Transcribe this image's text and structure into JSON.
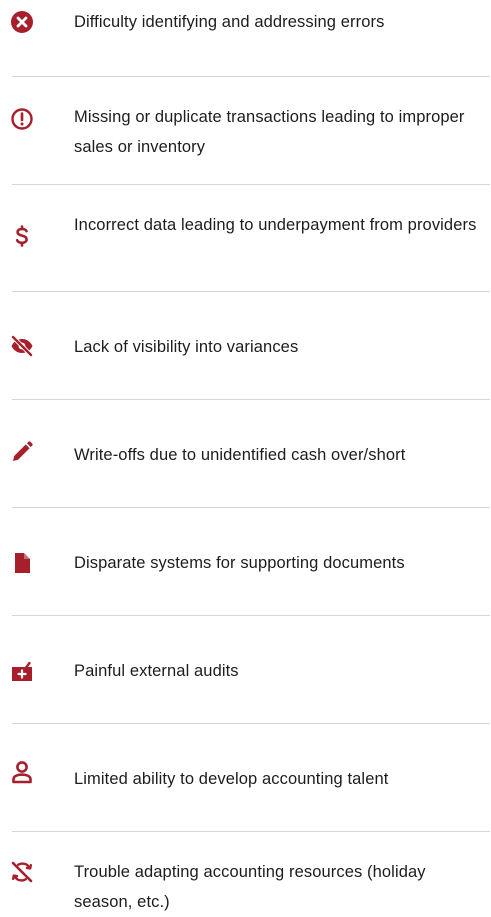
{
  "theme": {
    "accent_color": "#a61f2b",
    "text_color": "#1d1d1d",
    "divider_color": "#d6d6d6"
  },
  "items": [
    {
      "icon": "error-circle-icon",
      "label": "Difficulty identifying and addressing errors"
    },
    {
      "icon": "alert-circle-icon",
      "label": "Missing or duplicate transactions leading to improper sales or inventory"
    },
    {
      "icon": "dollar-icon",
      "label": "Incorrect data leading to underpayment from providers"
    },
    {
      "icon": "eye-off-icon",
      "label": "Lack of visibility into variances"
    },
    {
      "icon": "pencil-icon",
      "label": "Write-offs due to unidentified cash over/short"
    },
    {
      "icon": "document-icon",
      "label": "Disparate systems for supporting documents"
    },
    {
      "icon": "medical-bag-icon",
      "label": "Painful external audits"
    },
    {
      "icon": "user-icon",
      "label": "Limited ability to develop  accounting talent"
    },
    {
      "icon": "sync-off-icon",
      "label": "Trouble adapting accounting resources (holiday season, etc.)"
    }
  ]
}
